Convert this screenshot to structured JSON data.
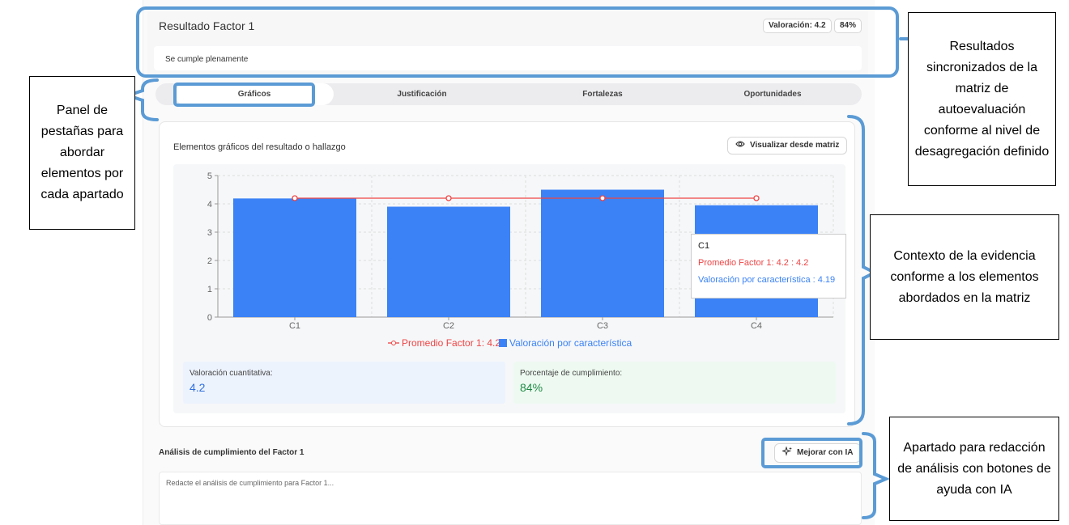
{
  "header": {
    "title": "Resultado Factor 1",
    "valoracion_chip": "Valoración: 4.2",
    "percent_chip": "84%",
    "status_text": "Se cumple plenamente"
  },
  "tabs": [
    {
      "label": "Gráficos",
      "active": true
    },
    {
      "label": "Justificación",
      "active": false
    },
    {
      "label": "Fortalezas",
      "active": false
    },
    {
      "label": "Oportunidades",
      "active": false
    }
  ],
  "graphics_panel": {
    "title": "Elementos gráficos del resultado o hallazgo",
    "view_button": "Visualizar desde matriz",
    "view_icon": "eye-icon"
  },
  "chart_data": {
    "type": "bar",
    "categories": [
      "C1",
      "C2",
      "C3",
      "C4"
    ],
    "series": [
      {
        "name": "Valoración por característica",
        "type": "bar",
        "color": "#3b82f6",
        "values": [
          4.19,
          3.9,
          4.5,
          3.95
        ]
      },
      {
        "name": "Promedio Factor 1: 4.2",
        "type": "line",
        "color": "#ef4444",
        "values": [
          4.2,
          4.2,
          4.2,
          4.2
        ]
      }
    ],
    "ylim": [
      0,
      5
    ],
    "yticks": [
      0,
      1,
      2,
      3,
      4,
      5
    ],
    "grid": true,
    "legend_position": "bottom",
    "tooltip": {
      "category": "C1",
      "line1": "Promedio Factor 1: 4.2 : 4.2",
      "line2": "Valoración por característica : 4.19"
    }
  },
  "stats": {
    "cuantitativa_label": "Valoración cuantitativa:",
    "cuantitativa_value": "4.2",
    "porcentaje_label": "Porcentaje de cumplimiento:",
    "porcentaje_value": "84%"
  },
  "analysis": {
    "title": "Análisis de cumplimiento del Factor 1",
    "improve_button": "Mejorar con IA",
    "improve_icon": "sparkles-icon",
    "placeholder": "Redacte el análisis de cumplimiento para Factor 1..."
  },
  "callouts": {
    "tabs_panel": "Panel de pestañas para abordar elementos por cada apartado",
    "results_sync": "Resultados sincronizados de la matriz de autoevaluación conforme al nivel de desagregación definido",
    "evidence_context": "Contexto de la evidencia conforme a los elementos abordados en la matriz",
    "analysis_section": "Apartado para redacción de análisis con botones de ayuda con IA"
  },
  "colors": {
    "bar": "#3b82f6",
    "line": "#ef4444",
    "annotation": "#5b9bd5"
  }
}
